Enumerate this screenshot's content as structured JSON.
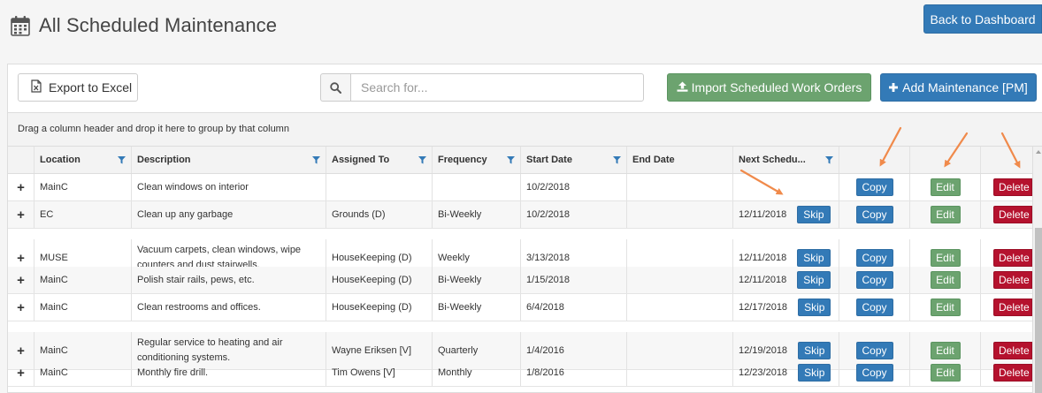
{
  "header": {
    "title": "All Scheduled Maintenance",
    "back_label": "Back to Dashboard"
  },
  "toolbar": {
    "export_label": "Export to Excel",
    "search_placeholder": "Search for...",
    "search_value": "",
    "import_label": "Import Scheduled Work Orders",
    "add_label": "Add Maintenance [PM]"
  },
  "group_bar": {
    "text": "Drag a column header and drop it here to group by that column"
  },
  "columns": [
    "Location",
    "Description",
    "Assigned To",
    "Frequency",
    "Start Date",
    "End Date",
    "Next Schedu..."
  ],
  "rows": [
    {
      "location": "MainC",
      "description": "Clean windows on interior",
      "assigned_to": "",
      "frequency": "",
      "start_date": "10/2/2018",
      "end_date": "",
      "next_date": "",
      "skip": ""
    },
    {
      "location": "EC",
      "description": "Clean up any garbage",
      "assigned_to": "Grounds (D)",
      "frequency": "Bi-Weekly",
      "start_date": "10/2/2018",
      "end_date": "",
      "next_date": "12/11/2018",
      "skip": "Skip"
    },
    {
      "location": "MUSE",
      "description": "Vacuum carpets, clean windows, wipe counters and dust stairwells.",
      "assigned_to": "HouseKeeping (D)",
      "frequency": "Weekly",
      "start_date": "3/13/2018",
      "end_date": "",
      "next_date": "12/11/2018",
      "skip": "Skip"
    },
    {
      "location": "MainC",
      "description": "Polish stair rails, pews, etc.",
      "assigned_to": "HouseKeeping (D)",
      "frequency": "Bi-Weekly",
      "start_date": "1/15/2018",
      "end_date": "",
      "next_date": "12/11/2018",
      "skip": "Skip"
    },
    {
      "location": "MainC",
      "description": "Clean restrooms and offices.",
      "assigned_to": "HouseKeeping (D)",
      "frequency": "Bi-Weekly",
      "start_date": "6/4/2018",
      "end_date": "",
      "next_date": "12/17/2018",
      "skip": "Skip"
    },
    {
      "location": "MainC",
      "description": "Regular service to heating and air conditioning systems.",
      "assigned_to": "Wayne Eriksen [V]",
      "frequency": "Quarterly",
      "start_date": "1/4/2016",
      "end_date": "",
      "next_date": "12/19/2018",
      "skip": "Skip"
    },
    {
      "location": "MainC",
      "description": "Monthly fire drill.",
      "assigned_to": "Tim Owens [V]",
      "frequency": "Monthly",
      "start_date": "1/8/2016",
      "end_date": "",
      "next_date": "12/23/2018",
      "skip": "Skip"
    }
  ],
  "row_actions": {
    "expand": "+",
    "copy": "Copy",
    "edit": "Edit",
    "delete": "Delete"
  },
  "colors": {
    "primary": "#337ab7",
    "success": "#6ca36f",
    "danger": "#b5122e",
    "annotation_arrow": "#f08a4b"
  },
  "icons": [
    "calendar-icon",
    "excel-file-icon",
    "search-icon",
    "upload-icon",
    "plus-icon",
    "filter-icon"
  ]
}
